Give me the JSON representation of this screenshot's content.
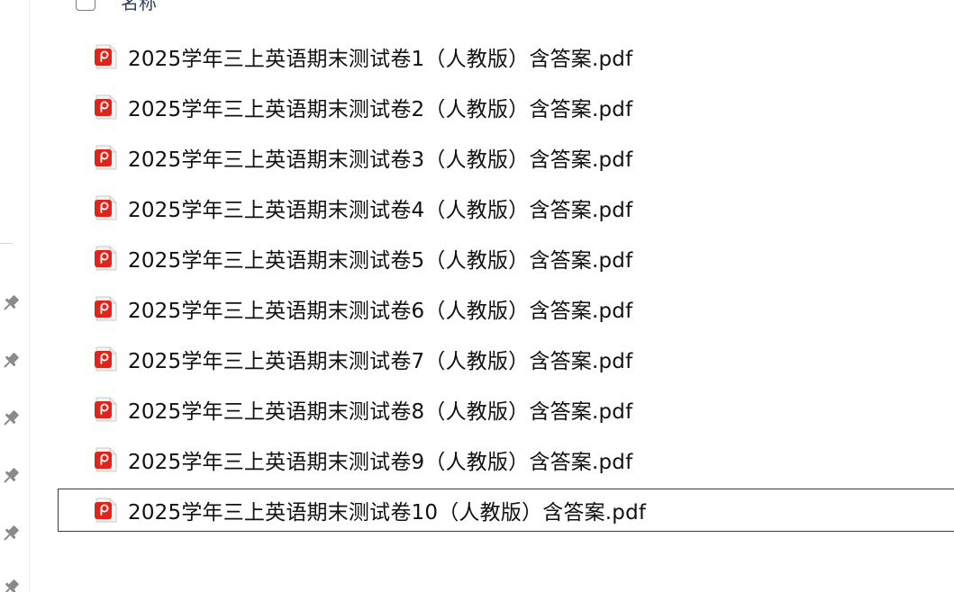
{
  "header": {
    "name_column_label": "名称"
  },
  "navigation": {
    "pinned_items": [
      {
        "icon": "pin-icon"
      },
      {
        "icon": "pin-icon"
      },
      {
        "icon": "pin-icon"
      },
      {
        "icon": "pin-icon"
      },
      {
        "icon": "pin-icon"
      },
      {
        "icon": "pin-icon"
      }
    ]
  },
  "files": [
    {
      "name": "2025学年三上英语期末测试卷1（人教版）含答案.pdf",
      "icon": "pdf-file-icon"
    },
    {
      "name": "2025学年三上英语期末测试卷2（人教版）含答案.pdf",
      "icon": "pdf-file-icon"
    },
    {
      "name": "2025学年三上英语期末测试卷3（人教版）含答案.pdf",
      "icon": "pdf-file-icon"
    },
    {
      "name": "2025学年三上英语期末测试卷4（人教版）含答案.pdf",
      "icon": "pdf-file-icon"
    },
    {
      "name": "2025学年三上英语期末测试卷5（人教版）含答案.pdf",
      "icon": "pdf-file-icon"
    },
    {
      "name": "2025学年三上英语期末测试卷6（人教版）含答案.pdf",
      "icon": "pdf-file-icon"
    },
    {
      "name": "2025学年三上英语期末测试卷7（人教版）含答案.pdf",
      "icon": "pdf-file-icon"
    },
    {
      "name": "2025学年三上英语期末测试卷8（人教版）含答案.pdf",
      "icon": "pdf-file-icon"
    },
    {
      "name": "2025学年三上英语期末测试卷9（人教版）含答案.pdf",
      "icon": "pdf-file-icon"
    },
    {
      "name": "2025学年三上英语期末测试卷10（人教版）含答案.pdf",
      "icon": "pdf-file-icon",
      "focused": true
    }
  ],
  "colors": {
    "pdf_icon_red": "#e2231a",
    "pin_gray": "#8a8a8a",
    "focus_border": "#3a3a3a"
  }
}
